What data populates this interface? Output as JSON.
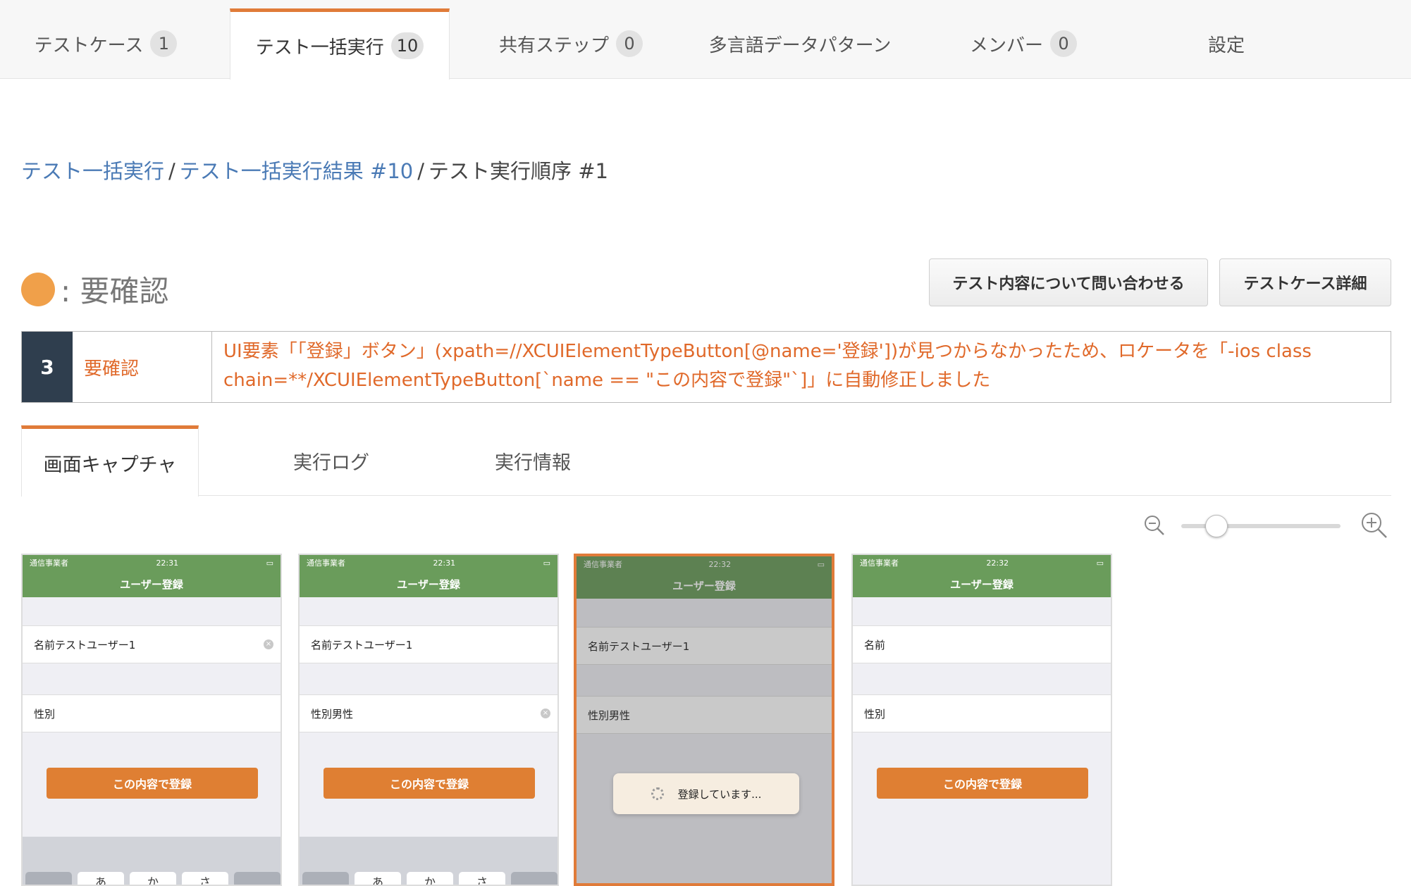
{
  "top_tabs": [
    {
      "label": "テストケース",
      "count": "1"
    },
    {
      "label": "テスト一括実行",
      "count": "10"
    },
    {
      "label": "共有ステップ",
      "count": "0"
    },
    {
      "label": "多言語データパターン"
    },
    {
      "label": "メンバー",
      "count": "0"
    },
    {
      "label": "設定"
    }
  ],
  "breadcrumb": {
    "link1": "テスト一括実行",
    "link2": "テスト一括実行結果 #10",
    "current": "テスト実行順序 #1",
    "separator": "/"
  },
  "status": {
    "text": ": 要確認",
    "color": "#f0a04a"
  },
  "buttons": {
    "inquiry": "テスト内容について問い合わせる",
    "detail": "テストケース詳細"
  },
  "message": {
    "number": "3",
    "label": "要確認",
    "text": "UI要素「「登録」ボタン」(xpath=//XCUIElementTypeButton[@name='登録'])が見つからなかったため、ロケータを「-ios class chain=**/XCUIElementTypeButton[`name == \"この内容で登録\"`]」に自動修正しました"
  },
  "sub_tabs": [
    "画面キャプチャ",
    "実行ログ",
    "実行情報"
  ],
  "icons": {
    "zoom_out": "zoom-out-icon",
    "zoom_in": "zoom-in-icon",
    "wifi": "wifi-icon",
    "battery": "battery-icon",
    "clear": "clear-icon",
    "spinner": "spinner-icon"
  },
  "zoom_level": 0.2,
  "captures": [
    {
      "carrier": "通信事業者",
      "time": "22:31",
      "title": "ユーザー登録",
      "name": "名前テストユーザー1",
      "gender": "性別",
      "button": "この内容で登録",
      "keys": [
        "あ",
        "か",
        "さ"
      ]
    },
    {
      "carrier": "通信事業者",
      "time": "22:31",
      "title": "ユーザー登録",
      "name": "名前テストユーザー1",
      "gender": "性別男性",
      "button": "この内容で登録",
      "keys": [
        "あ",
        "か",
        "さ"
      ]
    },
    {
      "carrier": "通信事業者",
      "time": "22:32",
      "title": "ユーザー登録",
      "name": "名前テストユーザー1",
      "gender": "性別男性",
      "button": "",
      "toast": "登録しています..."
    },
    {
      "carrier": "通信事業者",
      "time": "22:32",
      "title": "ユーザー登録",
      "name": "名前",
      "gender": "性別",
      "button": "この内容で登録"
    }
  ],
  "colors": {
    "accent": "#e07b39",
    "link": "#4a7ab5",
    "warning_text": "#e0692a",
    "nav_green": "#6a9c5b",
    "badge_dark": "#2f3e4e"
  }
}
